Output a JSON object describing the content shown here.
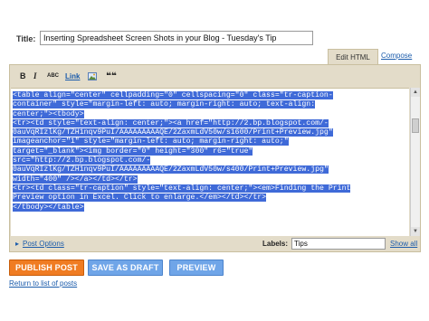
{
  "title_field": {
    "label": "Title:",
    "value": "Inserting Spreadsheet Screen Shots in your Blog - Tuesday's Tip"
  },
  "tabs": {
    "edit_html": "Edit HTML",
    "compose": "Compose"
  },
  "toolbar": {
    "bold": "B",
    "italic": "I",
    "spellcheck": "ABC",
    "link": "Link",
    "image_icon": "image-icon",
    "quote": "❝❝"
  },
  "code_lines": [
    "<table align=\"center\" cellpadding=\"0\" cellspacing=\"0\" class=\"tr-caption-",
    "container\" style=\"margin-left: auto; margin-right: auto; text-align:",
    "center;\"><tbody>",
    "<tr><td style=\"text-align: center;\"><a href=\"http://2.bp.blogspot.com/-",
    "0auVqRIzlKg/TZH1nqv9PuI/AAAAAAAAAQE/2ZaxmLdV50w/s1600/Print+Preview.jpg\"",
    "imageanchor=\"1\" style=\"margin-left: auto; margin-right: auto;\"",
    "target=\"_blank\"><img border=\"0\" height=\"300\" r6=\"true\"",
    "src=\"http://2.bp.blogspot.com/-",
    "0auVqRIzlKg/TZH1nqv9PuI/AAAAAAAAAQE/2ZaxmLdV50w/s400/Print+Preview.jpg\"",
    "width=\"400\" /></a></td></tr>",
    "<tr><td class=\"tr-caption\" style=\"text-align: center;\"><em>Finding the Print",
    "Preview option in Excel. Click to enlarge.</em></td></tr>",
    "</tbody></table>"
  ],
  "options_bar": {
    "post_options": "Post Options",
    "labels_label": "Labels:",
    "labels_value": "Tips",
    "show_all": "Show all"
  },
  "buttons": {
    "publish": "PUBLISH POST",
    "draft": "SAVE AS DRAFT",
    "preview": "PREVIEW"
  },
  "return_link": "Return to list of posts",
  "colors": {
    "publish": "#f07c22",
    "secondary": "#6fa5e8",
    "selection": "#3f6ad8",
    "panel": "#e3dcc9"
  }
}
